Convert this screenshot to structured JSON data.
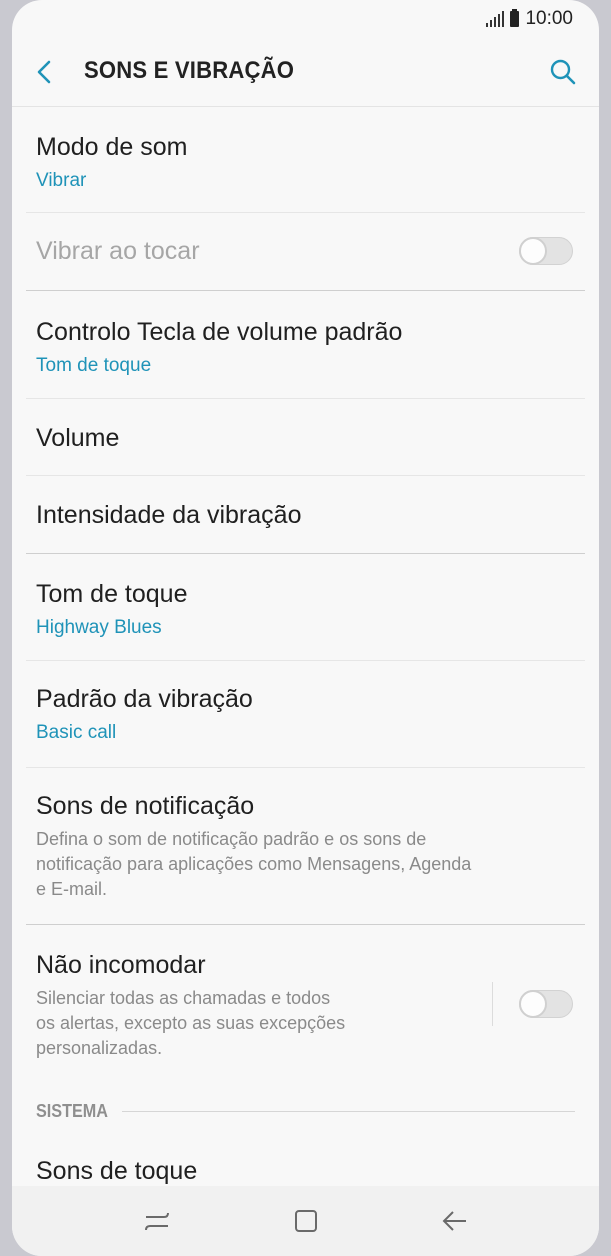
{
  "status": {
    "time": "10:00"
  },
  "header": {
    "title": "SONS E VIBRAÇÃO"
  },
  "items": [
    {
      "title": "Modo de som",
      "sub": "Vibrar"
    },
    {
      "title": "Vibrar ao tocar",
      "toggle": false
    },
    {
      "title": "Controlo Tecla de volume padrão",
      "sub": "Tom de toque"
    },
    {
      "title": "Volume"
    },
    {
      "title": "Intensidade da vibração"
    },
    {
      "title": "Tom de toque",
      "sub": "Highway Blues"
    },
    {
      "title": "Padrão da vibração",
      "sub": "Basic call"
    },
    {
      "title": "Sons de notificação",
      "desc_lines": [
        "Defina o som de notificação padrão e os sons de",
        "notificação para aplicações como Mensagens, Agenda",
        "e E-mail."
      ]
    },
    {
      "title": "Não incomodar",
      "desc_lines": [
        "Silenciar todas as chamadas e todos",
        "os alertas, excepto as suas excepções",
        "personalizadas."
      ],
      "toggle": false
    }
  ],
  "section": {
    "label": "SISTEMA"
  },
  "partial_item": {
    "title": "Sons de toque"
  },
  "colors": {
    "accent": "#1f93b8",
    "background": "#f8f8f8"
  }
}
